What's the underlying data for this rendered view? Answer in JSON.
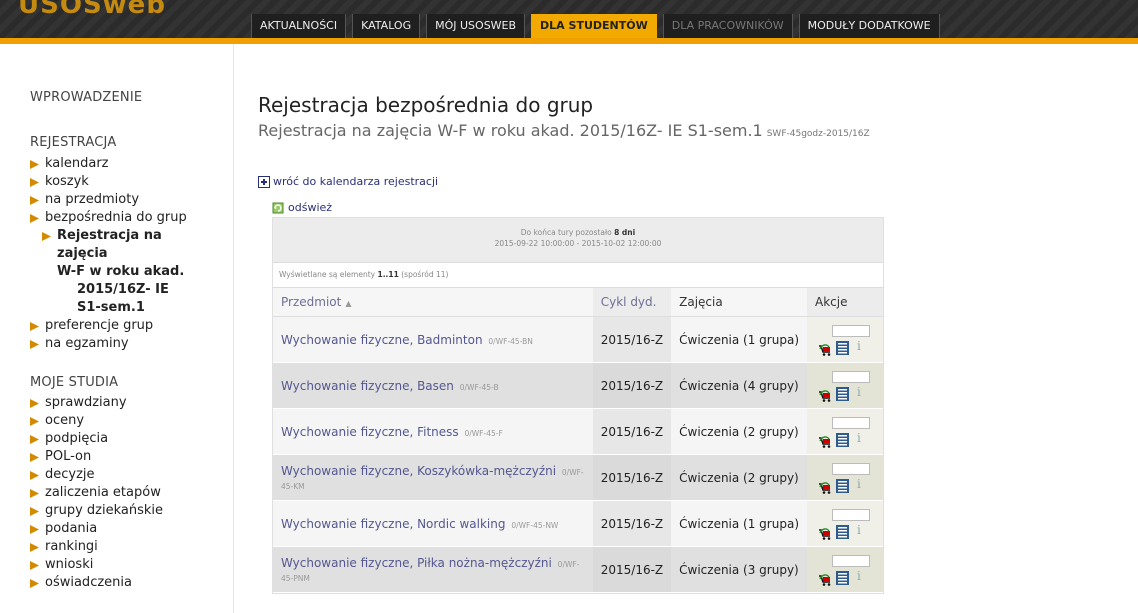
{
  "header": {
    "tabs": [
      {
        "label": "AKTUALNOŚCI",
        "state": "normal"
      },
      {
        "label": "KATALOG",
        "state": "normal"
      },
      {
        "label": "MÓJ USOSWEB",
        "state": "normal"
      },
      {
        "label": "DLA STUDENTÓW",
        "state": "active"
      },
      {
        "label": "DLA PRACOWNIKÓW",
        "state": "disabled"
      },
      {
        "label": "MODUŁY DODATKOWE",
        "state": "normal"
      }
    ],
    "accent": "#f2a900"
  },
  "sidebar": {
    "section1": "WPROWADZENIE",
    "section2": "REJESTRACJA",
    "reg_items": [
      "kalendarz",
      "koszyk",
      "na przedmioty",
      "bezpośrednia do grup"
    ],
    "reg_sub_current": [
      "Rejestracja na zajęcia",
      "W-F w roku akad.",
      "2015/16Z- IE",
      "S1-sem.1"
    ],
    "reg_items_after": [
      "preferencje grup",
      "na egzaminy"
    ],
    "section3": "MOJE STUDIA",
    "study_items": [
      "sprawdziany",
      "oceny",
      "podpięcia",
      "POL-on",
      "decyzje",
      "zaliczenia etapów",
      "grupy dziekańskie",
      "podania",
      "rankingi",
      "wnioski",
      "oświadczenia"
    ]
  },
  "main": {
    "title": "Rejestracja bezpośrednia do grup",
    "subtitle": "Rejestracja na zajęcia W-F w roku akad. 2015/16Z- IE S1-sem.1",
    "subtitle_code": "SWF-45godz-2015/16Z",
    "back_link": "wróć do kalendarza rejestracji",
    "refresh_link": "odśwież",
    "info_prefix": "Do końca tury pozostało",
    "info_days": "8 dni",
    "info_dates": "2015-09-22 10:00:00 - 2015-10-02 12:00:00",
    "count_prefix": "Wyświetlane są elementy",
    "count_range": "1..11",
    "count_suffix": "(spośród 11)",
    "columns": {
      "subject": "Przedmiot",
      "sort_symbol": "▲",
      "cycle": "Cykl dyd.",
      "classes": "Zajęcia",
      "actions": "Akcje"
    },
    "rows": [
      {
        "subject": "Wychowanie fizyczne, Badminton",
        "code": "0/WF-45-BN",
        "cycle": "2015/16-Z",
        "classes": "Ćwiczenia (1 grupa)"
      },
      {
        "subject": "Wychowanie fizyczne, Basen",
        "code": "0/WF-45-B",
        "cycle": "2015/16-Z",
        "classes": "Ćwiczenia (4 grupy)"
      },
      {
        "subject": "Wychowanie fizyczne, Fitness",
        "code": "0/WF-45-F",
        "cycle": "2015/16-Z",
        "classes": "Ćwiczenia (2 grupy)"
      },
      {
        "subject": "Wychowanie fizyczne, Koszykówka-mężczyźni",
        "code": "0/WF-45-KM",
        "cycle": "2015/16-Z",
        "classes": "Ćwiczenia (2 grupy)"
      },
      {
        "subject": "Wychowanie fizyczne, Nordic walking",
        "code": "0/WF-45-NW",
        "cycle": "2015/16-Z",
        "classes": "Ćwiczenia (1 grupa)"
      },
      {
        "subject": "Wychowanie fizyczne, Piłka nożna-mężczyźni",
        "code": "0/WF-45-PNM",
        "cycle": "2015/16-Z",
        "classes": "Ćwiczenia (3 grupy)"
      }
    ],
    "action_icons": [
      "cart-icon",
      "list-icon",
      "info-icon"
    ],
    "info_icon_glyph": "i"
  }
}
